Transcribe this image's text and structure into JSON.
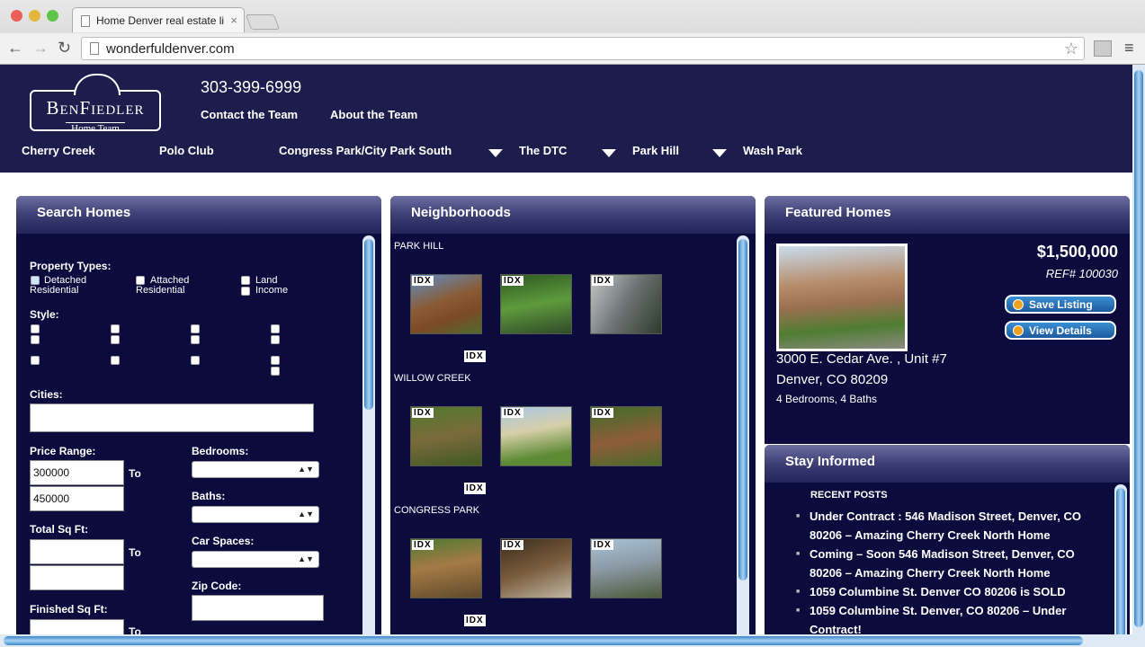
{
  "browser": {
    "tab_title": "Home Denver real estate li",
    "tab_close": "×",
    "url": "wonderfuldenver.com",
    "back": "←",
    "forward": "→",
    "reload": "↻",
    "star": "☆",
    "menu": "≡"
  },
  "header": {
    "logo_name": "BenFiedler",
    "logo_sub": "Home Team",
    "phone": "303-399-6999",
    "links": [
      "Contact the Team",
      "About the Team"
    ],
    "nav": [
      "Cherry Creek",
      "Polo Club",
      "Congress Park/City Park South",
      "The DTC",
      "Park Hill",
      "Wash Park"
    ]
  },
  "search": {
    "title": "Search Homes",
    "property_types_label": "Property Types:",
    "property_types": [
      {
        "label": "Detached Residential",
        "checked": true
      },
      {
        "label": "Attached Residential",
        "checked": false
      },
      {
        "label": "Land Income",
        "checked": false
      }
    ],
    "style_label": "Style:",
    "cities_label": "Cities:",
    "cities_value": "",
    "price_label": "Price Range:",
    "price_min": "300000",
    "price_max": "450000",
    "to": "To",
    "bedrooms_label": "Bedrooms:",
    "baths_label": "Baths:",
    "car_spaces_label": "Car Spaces:",
    "sqft_label": "Total Sq Ft:",
    "zip_label": "Zip Code:",
    "finished_label": "Finished Sq Ft:"
  },
  "neighborhoods": {
    "title": "Neighborhoods",
    "groups": [
      "PARK HILL",
      "WILLOW CREEK",
      "CONGRESS PARK"
    ],
    "idx": "IDX"
  },
  "featured": {
    "title": "Featured Homes",
    "price": "$1,500,000",
    "ref": "REF# 100030",
    "address1": "3000 E. Cedar Ave. , Unit #7",
    "address2": "Denver, CO 80209",
    "details": "4 Bedrooms, 4 Baths",
    "save": "Save Listing",
    "view": "View Details"
  },
  "informed": {
    "title": "Stay Informed",
    "recent": "RECENT POSTS",
    "posts": [
      "Under Contract : 546 Madison Street, Denver, CO 80206 – Amazing Cherry Creek North Home",
      "Coming – Soon 546 Madison Street, Denver, CO 80206 – Amazing Cherry Creek North Home",
      "1059 Columbine St. Denver CO 80206 is SOLD",
      "1059 Columbine St. Denver, CO 80206 – Under Contract!"
    ]
  }
}
